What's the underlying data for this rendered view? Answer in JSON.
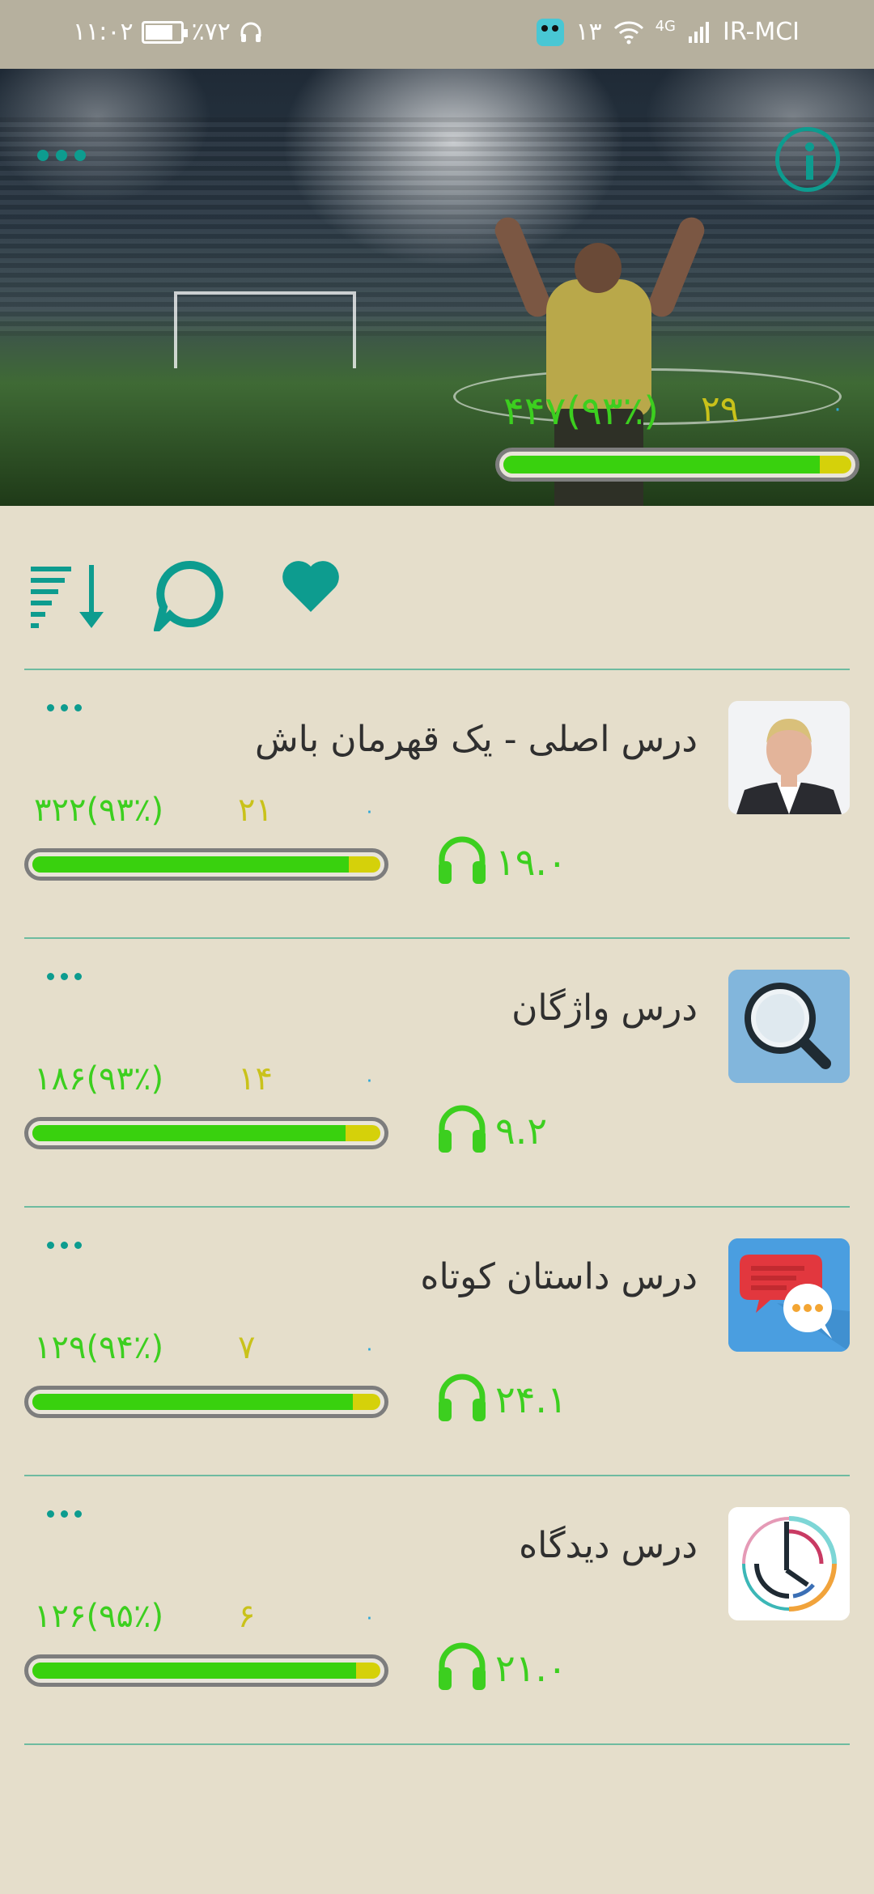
{
  "status_bar": {
    "time": "۱۱:۰۲",
    "battery": "٪۷۲",
    "notification_count": "۱۳",
    "network": "4G",
    "carrier": "IR-MCI"
  },
  "hero": {
    "stat_total": "۴۴۷(۹۳٪)",
    "stat_count": "۲۹",
    "stat_zero": "۰",
    "progress_fraction": 0.91
  },
  "toolbar": {
    "icons": [
      "sort-icon",
      "comment-icon",
      "favorite-icon"
    ]
  },
  "lessons": [
    {
      "title": "درس اصلی - یک قهرمان باش",
      "stat_total": "۳۲۲(۹۳٪)",
      "stat_count": "۲۱",
      "stat_zero": "۰",
      "duration": "۱۹.۰",
      "progress_fraction": 0.91,
      "thumb": "portrait"
    },
    {
      "title": "درس واژگان",
      "stat_total": "۱۸۶(۹۳٪)",
      "stat_count": "۱۴",
      "stat_zero": "۰",
      "duration": "۹.۲",
      "progress_fraction": 0.9,
      "thumb": "magnifier"
    },
    {
      "title": "درس داستان کوتاه",
      "stat_total": "۱۲۹(۹۴٪)",
      "stat_count": "۷",
      "stat_zero": "۰",
      "duration": "۲۴.۱",
      "progress_fraction": 0.92,
      "thumb": "chat-bubbles"
    },
    {
      "title": "درس دیدگاه",
      "stat_total": "۱۲۶(۹۵٪)",
      "stat_count": "۶",
      "stat_zero": "۰",
      "duration": "۲۱.۰",
      "progress_fraction": 0.93,
      "thumb": "clock"
    }
  ],
  "colors": {
    "accent": "#0d9c8f",
    "green": "#3ccf1f",
    "yellow": "#c9c21a",
    "blue": "#2aa7d8",
    "background": "#e5decb"
  }
}
